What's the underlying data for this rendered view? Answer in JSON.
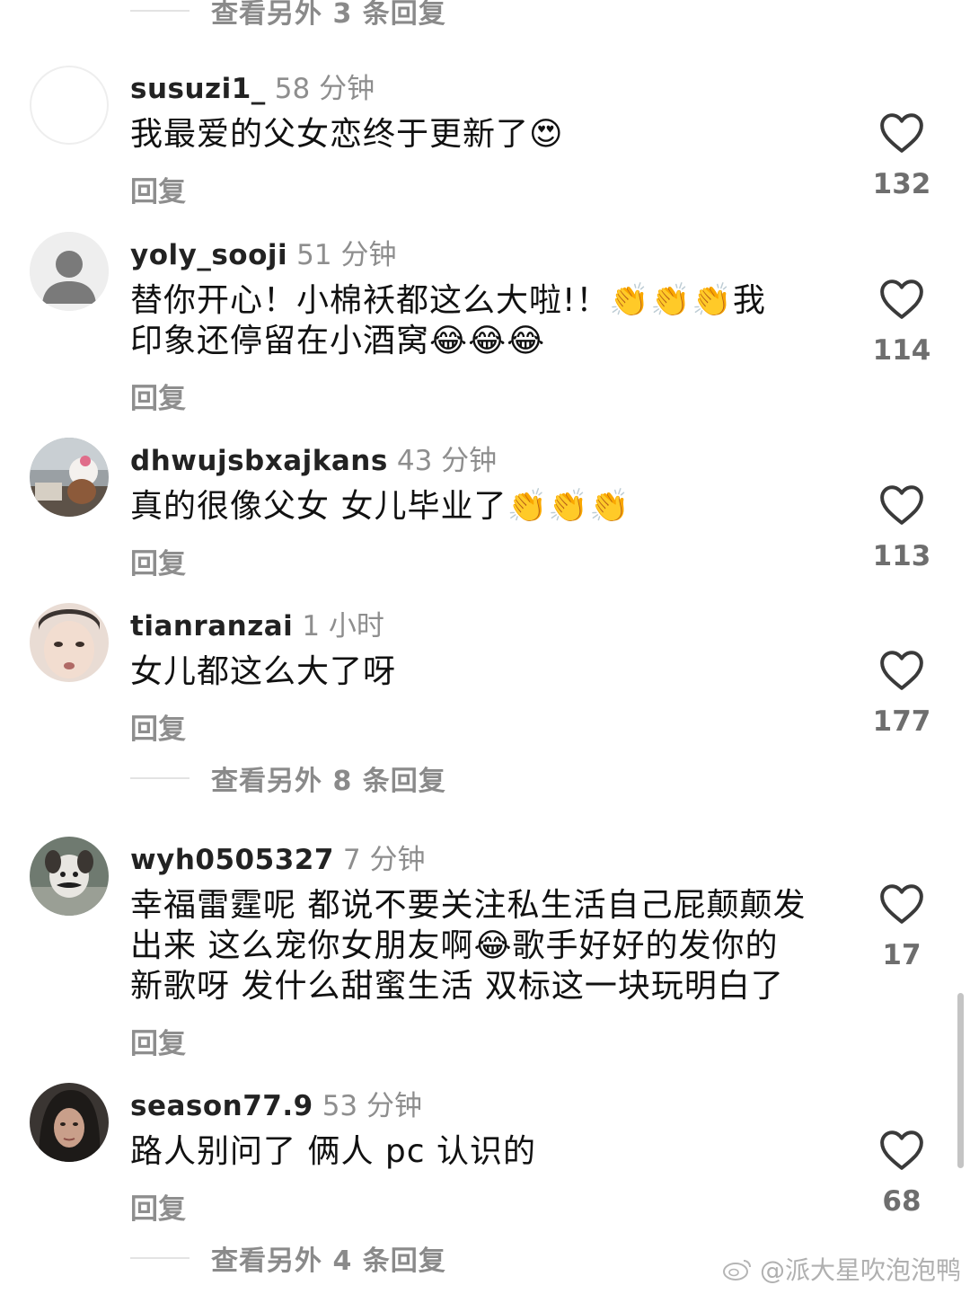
{
  "top_thread_toggle": "查看另外 3 条回复",
  "reply_label": "回复",
  "comments": [
    {
      "username": "susuzi1_",
      "time": "58 分钟",
      "text": "我最爱的父女恋终于更新了😍",
      "likes": "132",
      "avatar": "blank"
    },
    {
      "username": "yoly_sooji",
      "time": "51 分钟",
      "text": "替你开心！小棉袄都这么大啦!！👏👏👏我\n印象还停留在小酒窝😂😂😂",
      "likes": "114",
      "avatar": "default-person-icon"
    },
    {
      "username": "dhwujsbxajkans",
      "time": "43 分钟",
      "text": "真的很像父女 女儿毕业了👏👏👏",
      "likes": "113",
      "avatar": "photo-plush-toy"
    },
    {
      "username": "tianranzai",
      "time": "1 小时",
      "text": "女儿都这么大了呀",
      "likes": "177",
      "avatar": "photo-face"
    },
    {
      "username": "wyh0505327",
      "time": "7 分钟",
      "text": "幸福雷霆呢 都说不要关注私生活自己屁颠颠发\n出来 这么宠你女朋友啊😂歌手好好的发你的\n新歌呀 发什么甜蜜生活 双标这一块玩明白了",
      "likes": "17",
      "avatar": "photo-dog"
    },
    {
      "username": "season77.9",
      "time": "53 分钟",
      "text": "路人别问了 俩人 pc 认识的",
      "likes": "68",
      "avatar": "photo-person"
    }
  ],
  "thread_toggles": {
    "after_tianranzai": "查看另外 8 条回复",
    "after_season": "查看另外 4 条回复"
  },
  "watermark": "@派大星吹泡泡鸭",
  "colors": {
    "text": "#111111",
    "muted": "#8e8e8e",
    "count": "#6e6e6e",
    "divider": "#e3e3e3"
  }
}
